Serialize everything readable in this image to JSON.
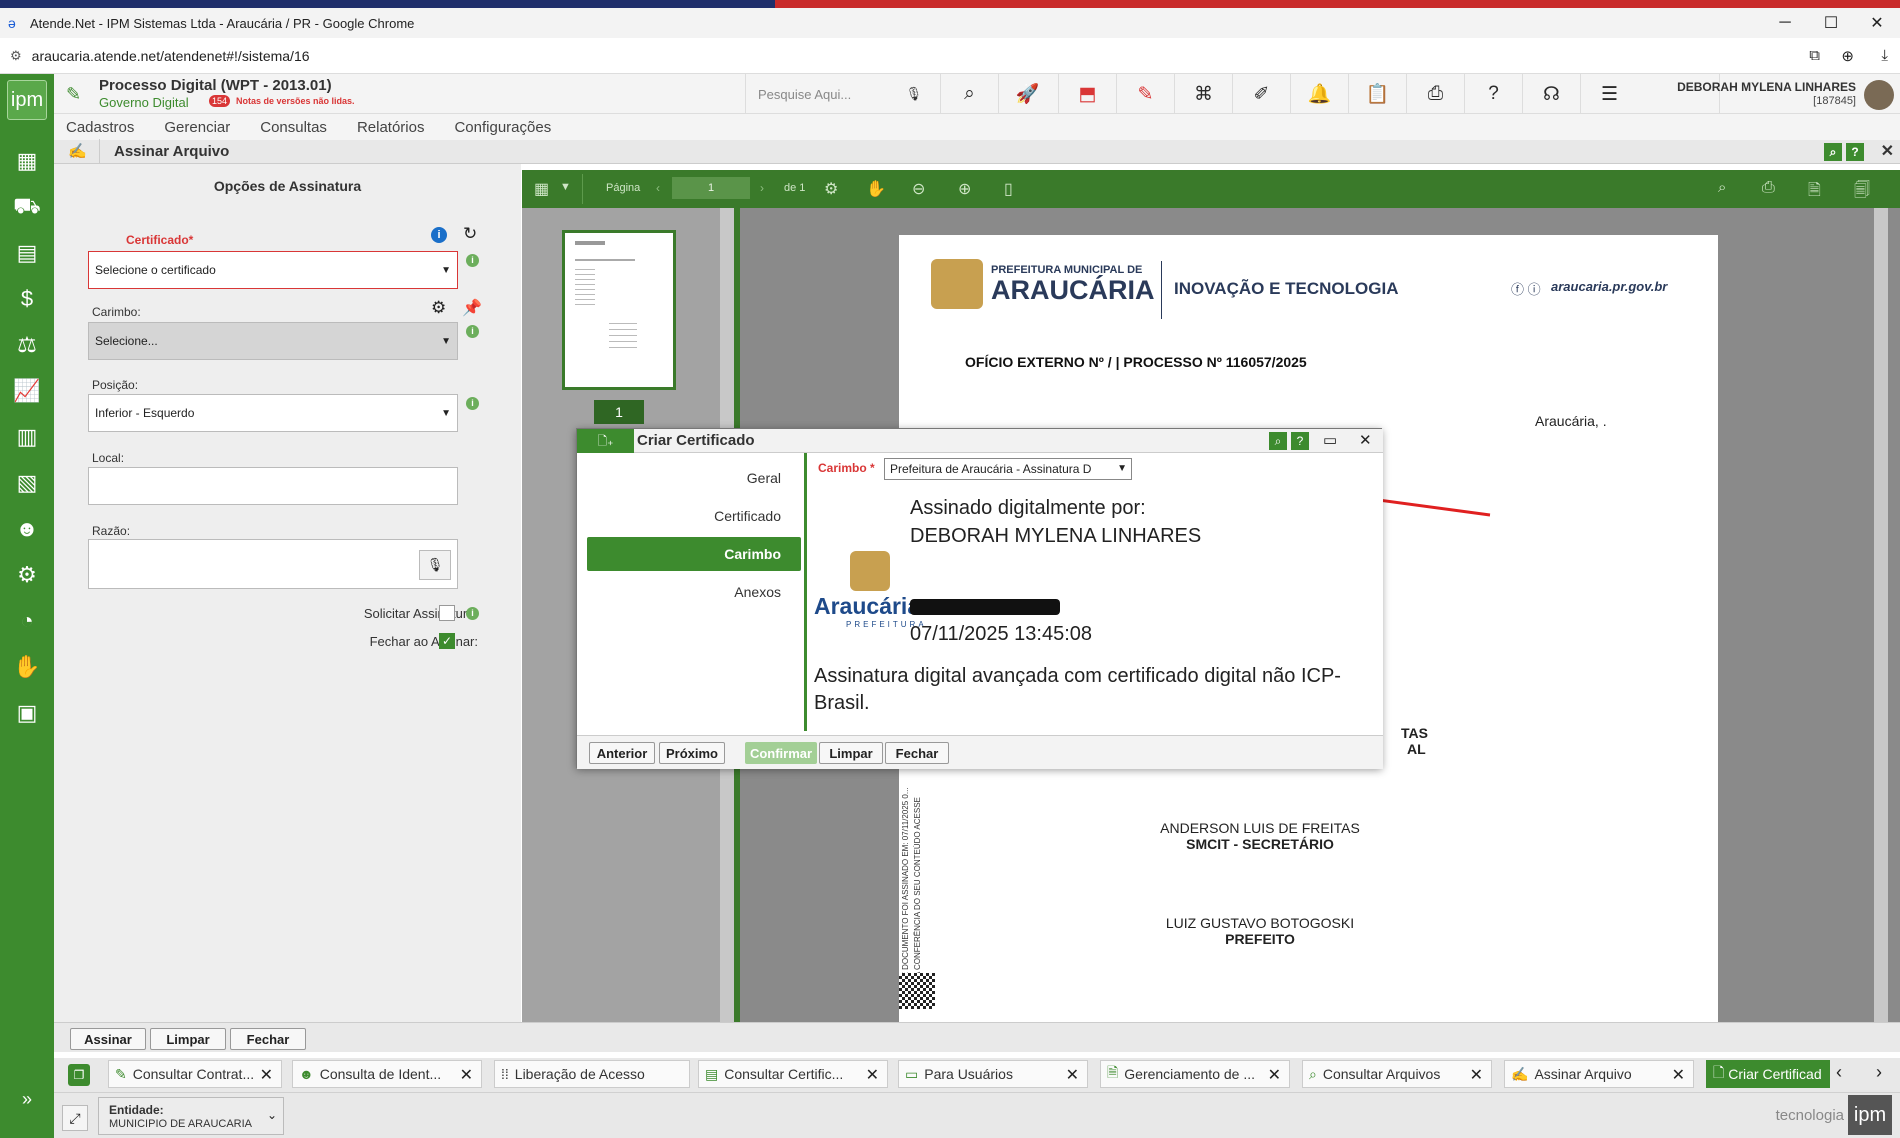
{
  "window": {
    "title": "Atende.Net - IPM Sistemas Ltda - Araucária / PR - Google Chrome",
    "url": "araucaria.atende.net/atendenet#!/sistema/16"
  },
  "app": {
    "title": "Processo Digital (WPT - 2013.01)",
    "subtitle": "Governo Digital",
    "notes_count": "154",
    "notes_text": "Notas de versões não lidas.",
    "search_placeholder": "Pesquise Aqui...",
    "user_name": "DEBORAH MYLENA LINHARES",
    "user_id": "[187845]",
    "logo_text": "ipm"
  },
  "menu": [
    "Cadastros",
    "Gerenciar",
    "Consultas",
    "Relatórios",
    "Configurações"
  ],
  "page_title": "Assinar Arquivo",
  "form": {
    "heading": "Opções de Assinatura",
    "certificado_label": "Certificado*",
    "certificado_value": "Selecione o certificado",
    "carimbo_label": "Carimbo:",
    "carimbo_value": "Selecione...",
    "posicao_label": "Posição:",
    "posicao_value": "Inferior - Esquerdo",
    "local_label": "Local:",
    "razao_label": "Razão:",
    "solicitar_label": "Solicitar Assinatura:",
    "fechar_label": "Fechar ao Assinar:"
  },
  "viewer": {
    "page_label": "Página",
    "page_value": "1",
    "of_label": "de 1",
    "thumb_page": "1"
  },
  "doc": {
    "org_top": "PREFEITURA MUNICIPAL DE",
    "org_name": "ARAUCÁRIA",
    "dept": "INOVAÇÃO E TECNOLOGIA",
    "site": "araucaria.pr.gov.br",
    "heading": "OFÍCIO EXTERNO Nº / | PROCESSO Nº 116057/2025",
    "place": "Araucária, .",
    "frag1": "TAS",
    "frag2": "AL",
    "sig1_name": "ANDERSON LUIS DE FREITAS",
    "sig1_role": "SMCIT - SECRETÁRIO",
    "sig2_name": "LUIZ GUSTAVO BOTOGOSKI",
    "sig2_role": "PREFEITO",
    "side_text1": "ESTE DOCUMENTO FOI ASSINADO EM: 07/11/2025 0...",
    "side_text2": "PARA CONFERÊNCIA DO SEU CONTEÚDO ACESSE"
  },
  "modal": {
    "title": "Criar Certificado",
    "nav": [
      "Geral",
      "Certificado",
      "Carimbo",
      "Anexos"
    ],
    "active_nav": "Carimbo",
    "carimbo_label": "Carimbo *",
    "carimbo_value": "Prefeitura de Araucária - Assinatura D",
    "stamp_line1": "Assinado digitalmente por:",
    "stamp_name": "DEBORAH MYLENA LINHARES",
    "stamp_date": "07/11/2025 13:45:08",
    "stamp_logo": "Araucária",
    "stamp_logo_sub": "PREFEITURA",
    "stamp_footer": "Assinatura digital avançada com certificado digital não ICP-Brasil.",
    "buttons": {
      "prev": "Anterior",
      "next": "Próximo",
      "confirm": "Confirmar",
      "clear": "Limpar",
      "close": "Fechar"
    }
  },
  "bottom_buttons": {
    "sign": "Assinar",
    "clear": "Limpar",
    "close": "Fechar"
  },
  "tabs": [
    "Consultar Contrat...",
    "Consulta de Ident...",
    "Liberação de Acesso",
    "Consultar Certific...",
    "Para Usuários",
    "Gerenciamento de ...",
    "Consultar Arquivos",
    "Assinar Arquivo",
    "Criar Certificad"
  ],
  "status": {
    "entity_label": "Entidade:",
    "entity_value": "MUNICIPIO DE ARAUCARIA",
    "brand": "tecnologia",
    "brand_logo": "ipm"
  },
  "colors": {
    "accent": "#3d8b2e",
    "danger": "#d93636",
    "arrow": "#e02020"
  }
}
